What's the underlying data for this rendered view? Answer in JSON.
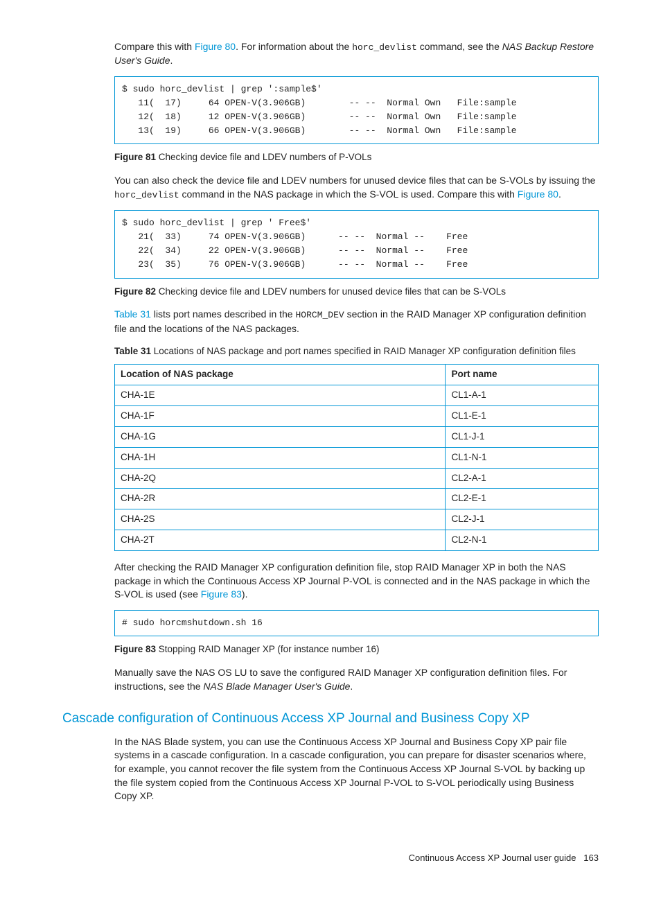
{
  "intro": {
    "pre": "Compare this with ",
    "link1": "Figure 80",
    "mid": ". For information about the ",
    "code1": "horc_devlist",
    "post1": " command, see the ",
    "ital1": "NAS Backup Restore User's Guide",
    "end": "."
  },
  "codebox1": "$ sudo horc_devlist | grep ':sample$'\n   11(  17)     64 OPEN-V(3.906GB)        -- --  Normal Own   File:sample\n   12(  18)     12 OPEN-V(3.906GB)        -- --  Normal Own   File:sample\n   13(  19)     66 OPEN-V(3.906GB)        -- --  Normal Own   File:sample",
  "fig81": {
    "lead": "Figure 81",
    "text": " Checking device file and LDEV numbers of P-VOLs"
  },
  "para2": {
    "text1": "You can also check the device file and LDEV numbers for unused device files that can be S-VOLs by issuing the ",
    "code": "horc_devlist",
    "text2": " command in the NAS package in which the S-VOL is used. Compare this with ",
    "link": "Figure 80",
    "text3": "."
  },
  "codebox2": "$ sudo horc_devlist | grep ' Free$'\n   21(  33)     74 OPEN-V(3.906GB)      -- --  Normal --    Free\n   22(  34)     22 OPEN-V(3.906GB)      -- --  Normal --    Free\n   23(  35)     76 OPEN-V(3.906GB)      -- --  Normal --    Free",
  "fig82": {
    "lead": "Figure 82",
    "text": " Checking device file and LDEV numbers for unused device files that can be S-VOLs"
  },
  "para3": {
    "link": "Table 31",
    "text1": " lists port names described in the ",
    "code": "HORCM_DEV",
    "text2": " section in the RAID Manager XP configuration definition file and the locations of the NAS packages."
  },
  "tbl31": {
    "lead": "Table 31",
    "caption": "   Locations of NAS package and port names specified in RAID Manager XP configuration definition files",
    "headers": [
      "Location of NAS package",
      "Port name"
    ],
    "rows": [
      [
        "CHA-1E",
        "CL1-A-1"
      ],
      [
        "CHA-1F",
        "CL1-E-1"
      ],
      [
        "CHA-1G",
        "CL1-J-1"
      ],
      [
        "CHA-1H",
        "CL1-N-1"
      ],
      [
        "CHA-2Q",
        "CL2-A-1"
      ],
      [
        "CHA-2R",
        "CL2-E-1"
      ],
      [
        "CHA-2S",
        "CL2-J-1"
      ],
      [
        "CHA-2T",
        "CL2-N-1"
      ]
    ]
  },
  "para4": {
    "text1": "After checking the RAID Manager XP configuration definition file, stop RAID Manager XP in both the NAS package in which the Continuous Access XP Journal P-VOL is connected and in the NAS package in which the S-VOL is used (see ",
    "link": "Figure 83",
    "text2": ")."
  },
  "codebox3": "# sudo horcmshutdown.sh 16",
  "fig83": {
    "lead": "Figure 83",
    "text": " Stopping RAID Manager XP (for instance number 16)"
  },
  "para5": {
    "text1": "Manually save the NAS OS LU to save the configured RAID Manager XP configuration definition files. For instructions, see the ",
    "ital": "NAS Blade Manager User's Guide",
    "text2": "."
  },
  "section_heading": "Cascade configuration of Continuous Access XP Journal and Business Copy XP",
  "para6": "In the NAS Blade system, you can use the Continuous Access XP Journal and Business Copy XP pair file systems in a cascade configuration. In a cascade configuration, you can prepare for disaster scenarios where, for example, you cannot recover the file system from the Continuous Access XP Journal S-VOL by backing up the file system copied from the Continuous Access XP Journal P-VOL to S-VOL periodically using Business Copy XP.",
  "footer": {
    "title": "Continuous Access XP Journal user guide",
    "page": "163"
  }
}
